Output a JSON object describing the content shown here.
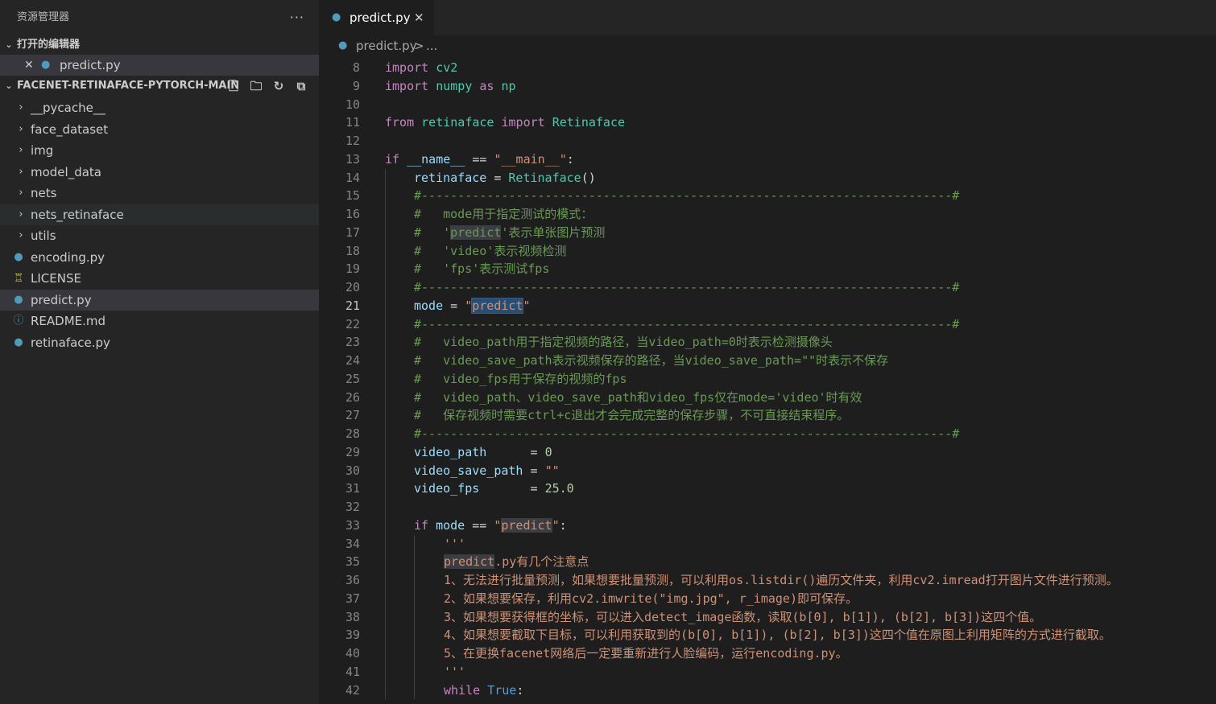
{
  "sidebar": {
    "title": "资源管理器",
    "more": "···",
    "open_editors": {
      "heading": "打开的编辑器",
      "items": [
        {
          "label": "predict.py"
        }
      ]
    },
    "project": {
      "heading": "FACENET-RETINAFACE-PYTORCH-MAIN",
      "items": [
        {
          "label": "__pycache__"
        },
        {
          "label": "face_dataset"
        },
        {
          "label": "img"
        },
        {
          "label": "model_data"
        },
        {
          "label": "nets"
        },
        {
          "label": "nets_retinaface"
        },
        {
          "label": "utils"
        },
        {
          "label": "encoding.py"
        },
        {
          "label": "LICENSE"
        },
        {
          "label": "predict.py"
        },
        {
          "label": "README.md"
        },
        {
          "label": "retinaface.py"
        }
      ]
    }
  },
  "editor": {
    "tab": {
      "label": "predict.py"
    },
    "breadcrumb": {
      "file": "predict.py",
      "sep": ">",
      "more": "..."
    },
    "line_numbers": [
      "8",
      "9",
      "10",
      "11",
      "12",
      "13",
      "14",
      "15",
      "16",
      "17",
      "18",
      "19",
      "20",
      "21",
      "22",
      "23",
      "24",
      "25",
      "26",
      "27",
      "28",
      "29",
      "30",
      "31",
      "32",
      "33",
      "34",
      "35",
      "36",
      "37",
      "38",
      "39",
      "40",
      "41",
      "42"
    ],
    "lines": {
      "l8": [
        "import",
        "cv2"
      ],
      "l9": [
        "import",
        "numpy",
        "as",
        "np"
      ],
      "l11": [
        "from",
        "retinaface",
        "import",
        "Retinaface"
      ],
      "l13": [
        "if",
        "__name__",
        "==",
        "\"__main__\"",
        ":"
      ],
      "l14": [
        "retinaface",
        "=",
        "Retinaface",
        "()"
      ],
      "l15": "#-------------------------------------------------------------------------#",
      "l16": "#   mode用于指定测试的模式：",
      "l17": [
        "#   '",
        "predict",
        "'表示单张图片预测"
      ],
      "l18": "#   'video'表示视频检测",
      "l19": "#   'fps'表示测试fps",
      "l20": "#-------------------------------------------------------------------------#",
      "l21": [
        "mode",
        "=",
        "\"",
        "predict",
        "\""
      ],
      "l22": "#-------------------------------------------------------------------------#",
      "l23": "#   video_path用于指定视频的路径，当video_path=0时表示检测摄像头",
      "l24": "#   video_save_path表示视频保存的路径，当video_save_path=\"\"时表示不保存",
      "l25": "#   video_fps用于保存的视频的fps",
      "l26": "#   video_path、video_save_path和video_fps仅在mode='video'时有效",
      "l27": "#   保存视频时需要ctrl+c退出才会完成完整的保存步骤，不可直接结束程序。",
      "l28": "#-------------------------------------------------------------------------#",
      "l29": [
        "video_path",
        "      = ",
        "0"
      ],
      "l30": [
        "video_save_path",
        " = ",
        "\"\""
      ],
      "l31": [
        "video_fps",
        "       = ",
        "25.0"
      ],
      "l33": [
        "if",
        "mode",
        "==",
        "\"",
        "predict",
        "\"",
        ":"
      ],
      "l34": "'''",
      "l35": [
        "predict",
        ".py有几个注意点"
      ],
      "l36": "1、无法进行批量预测，如果想要批量预测，可以利用os.listdir()遍历文件夹，利用cv2.imread打开图片文件进行预测。",
      "l37": "2、如果想要保存，利用cv2.imwrite(\"img.jpg\", r_image)即可保存。",
      "l38": "3、如果想要获得框的坐标，可以进入detect_image函数，读取(b[0], b[1]), (b[2], b[3])这四个值。",
      "l39": "4、如果想要截取下目标，可以利用获取到的(b[0], b[1]), (b[2], b[3])这四个值在原图上利用矩阵的方式进行截取。",
      "l40": "5、在更换facenet网络后一定要重新进行人脸编码，运行encoding.py。",
      "l41": "'''",
      "l42": [
        "while",
        "True",
        ":"
      ]
    }
  },
  "colors": {
    "keyword": "#569cd6",
    "control": "#c586c0",
    "class": "#4ec9b0",
    "variable": "#9cdcfe",
    "string": "#ce9178",
    "number": "#b5cea8",
    "comment": "#6a9955"
  },
  "icons": {
    "python": "python-file-icon",
    "license": "license-icon",
    "readme": "info-icon",
    "new_file": "new-file-icon",
    "new_folder": "new-folder-icon",
    "refresh": "refresh-icon",
    "collapse": "collapse-all-icon"
  }
}
